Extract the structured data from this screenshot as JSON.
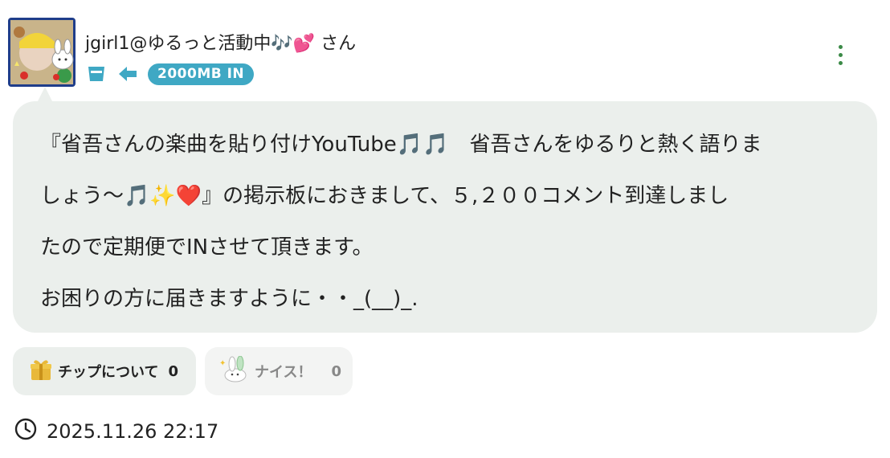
{
  "post": {
    "username": "jgirl1@ゆるっと活動中🎶💕 さん",
    "badge": "2000MB IN",
    "icons": {
      "cup": "cup-icon",
      "arrow": "arrow-left-icon",
      "more": "more-vertical-icon"
    },
    "body_lines": [
      "『省吾さんの楽曲を貼り付けYouTube🎵🎵　省吾さんをゆるりと熱く語りま",
      "しょう〜🎵✨",
      "』の掲示板におきまして、５,２００コメント到達しまし",
      "たので定期便でINさせて頂きます。",
      "お困りの方に届きますように・・_(__)_."
    ],
    "heart": "❤️",
    "tip": {
      "label": "チップについて",
      "count": "0",
      "icon": "gift-icon"
    },
    "nice": {
      "label": "ナイス！",
      "count": "0",
      "icon": "bunny-icon"
    },
    "timestamp": "2025.11.26 22:17",
    "colors": {
      "accent": "#3fa8c4",
      "menu": "#3b8a47",
      "bubble": "#ebefec",
      "gift": "#e8b83a"
    }
  }
}
